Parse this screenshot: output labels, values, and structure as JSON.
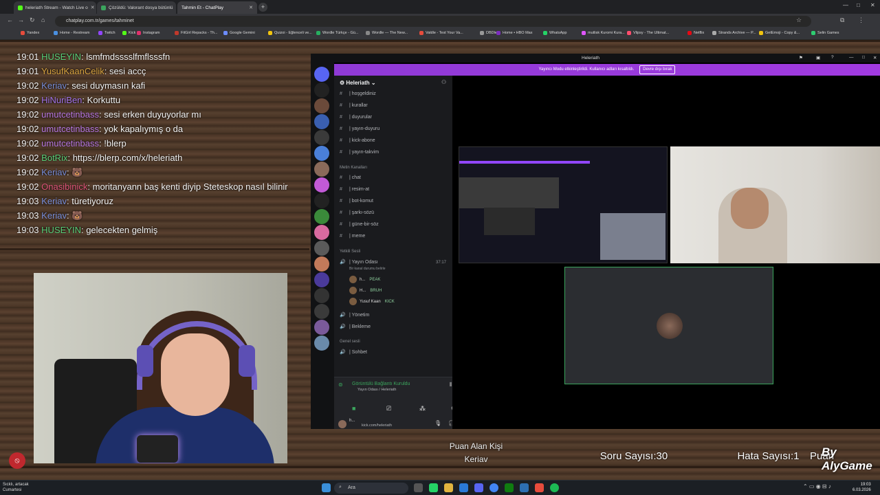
{
  "browser": {
    "tabs": [
      {
        "label": "heleriath Stream - Watch Live o",
        "color": "#53fc18"
      },
      {
        "label": "Çözüldü: Valorant dosya bütünlü",
        "color": "#3ba55d"
      },
      {
        "label": "Tahmin Et - ChatPlay",
        "color": "#9b59ff"
      }
    ],
    "new_tab": "+",
    "url": "chatplay.com.tr/games/tahminet",
    "bookmarks": [
      {
        "label": "Yandex",
        "color": "#e74c3c"
      },
      {
        "label": "Home - Restream",
        "color": "#4a90e2"
      },
      {
        "label": "Twitch",
        "color": "#9146ff"
      },
      {
        "label": "Kick",
        "color": "#53fc18"
      },
      {
        "label": "Instagram",
        "color": "#e1306c"
      },
      {
        "label": "FitGirl Repacks - Th...",
        "color": "#c0392b"
      },
      {
        "label": "Google Gemini",
        "color": "#6c8cff"
      },
      {
        "label": "Quizoi - Eğlenceli ve...",
        "color": "#f1c40f"
      },
      {
        "label": "Wordle Türkçe - Gü...",
        "color": "#27ae60"
      },
      {
        "label": "Wordle — The New...",
        "color": "#888888"
      },
      {
        "label": "Valdle - Test Your Va...",
        "color": "#e74c3c"
      },
      {
        "label": "DBDle",
        "color": "#999999"
      },
      {
        "label": "Home • HBO Max",
        "color": "#7b2cbf"
      },
      {
        "label": "WhatsApp",
        "color": "#25d366"
      },
      {
        "label": "mutlisk Kuromi Kura...",
        "color": "#e056fd"
      },
      {
        "label": "Vlipsy - The Ultimat...",
        "color": "#ff4d6d"
      },
      {
        "label": "Netflix",
        "color": "#e50914"
      },
      {
        "label": "Strands Archive — P...",
        "color": "#aaaaaa"
      },
      {
        "label": "GetEmoji - Copy &...",
        "color": "#f1c40f"
      },
      {
        "label": "Selin Games",
        "color": "#2ecc71"
      }
    ]
  },
  "chat": [
    {
      "time": "19:01",
      "user": "HUSEYIN",
      "color": "#5ad07a",
      "msg": "lsmfmdsssslfmflsssfn"
    },
    {
      "time": "19:01",
      "user": "YusufKaanCelik",
      "color": "#d9a441",
      "msg": "sesi accç"
    },
    {
      "time": "19:02",
      "user": "Keriav",
      "color": "#7a8fd8",
      "msg": "sesi duymasın kafi"
    },
    {
      "time": "19:02",
      "user": "HiNuriBen",
      "color": "#a374e8",
      "msg": "Korkuttu"
    },
    {
      "time": "19:02",
      "user": "umutcetinbass",
      "color": "#b777e0",
      "msg": "sesi erken duyuyorlar mı"
    },
    {
      "time": "19:02",
      "user": "umutcetinbass",
      "color": "#b777e0",
      "msg": "yok kapalıymış o da"
    },
    {
      "time": "19:02",
      "user": "umutcetinbass",
      "color": "#b777e0",
      "msg": "!blerp"
    },
    {
      "time": "19:02",
      "user": "BotRix",
      "color": "#5ad07a",
      "msg": "https://blerp.com/x/heleriath"
    },
    {
      "time": "19:02",
      "user": "Keriav",
      "color": "#7a8fd8",
      "msg": "🐻"
    },
    {
      "time": "19:02",
      "user": "Onasibinick",
      "color": "#e0557a",
      "msg": "moritanyann baş kenti diyip Steteskop nasıl bilinir"
    },
    {
      "time": "19:03",
      "user": "Keriav",
      "color": "#7a8fd8",
      "msg": "türetiyoruz"
    },
    {
      "time": "19:03",
      "user": "Keriav",
      "color": "#7a8fd8",
      "msg": "🐻"
    },
    {
      "time": "19:03",
      "user": "HUSEYIN",
      "color": "#5ad07a",
      "msg": "gelecekten gelmiş"
    }
  ],
  "discord": {
    "title": "Heleriath",
    "banner": "Yayıncı Modu etkinleştirildi. Kullanıcı adları kısaltıldı.",
    "banner_button": "Devre dışı bırak",
    "server_name": "Heleriath",
    "channels_top": [
      {
        "label": "| hoşgeldiniz",
        "icon": "#"
      },
      {
        "label": "| kurallar",
        "icon": "#"
      },
      {
        "label": "| duyurular",
        "icon": "#"
      },
      {
        "label": "| yayın-duyuru",
        "icon": "#"
      },
      {
        "label": "| kick-abone",
        "icon": "#"
      },
      {
        "label": "| yayın-takvim",
        "icon": "#"
      }
    ],
    "cat_text": "Metin Kanalları",
    "channels_text": [
      {
        "label": "| chat",
        "icon": "#"
      },
      {
        "label": "| resim-at",
        "icon": "#"
      },
      {
        "label": "| bot-komut",
        "icon": "#"
      },
      {
        "label": "| şarkı-sözü",
        "icon": "#"
      },
      {
        "label": "| güne-bir-söz",
        "icon": "#"
      },
      {
        "label": "| meme",
        "icon": "#"
      }
    ],
    "cat_voice": "Yetkili Sesli",
    "voice_channel": "| Yayın Odası",
    "voice_time": "37:17",
    "voice_status": "Bir kanal durumu belirle",
    "voice_users": [
      {
        "name": "h...",
        "tag": "PEAK"
      },
      {
        "name": "H...",
        "tag": "BRUH"
      },
      {
        "name": "Yusuf Kaan",
        "tag": "KICK"
      }
    ],
    "voice_more": [
      {
        "label": "| Yönetim"
      },
      {
        "label": "| Bekleme"
      }
    ],
    "cat_general": "Genel sesli",
    "general_channel": "| Sohbet",
    "connection": "Görüntülü Bağlantı Kuruldu",
    "connection_sub": "Yayın Odası / Heleriath",
    "user_name": "h...",
    "user_status": "kick.com/heleriath"
  },
  "overlay": {
    "puan_label": "Puan Alan Kişi",
    "puan_value": "Keriav",
    "soru": "Soru Sayısı:30",
    "hata": "Hata Sayısı:1",
    "puan2": "Puan",
    "logo": "By AlyGame"
  },
  "taskbar": {
    "weather_1": "Sıcklı, artacak",
    "weather_2": "Cumartesi",
    "search": "Ara",
    "time": "19:03",
    "date": "6.03.2026"
  }
}
